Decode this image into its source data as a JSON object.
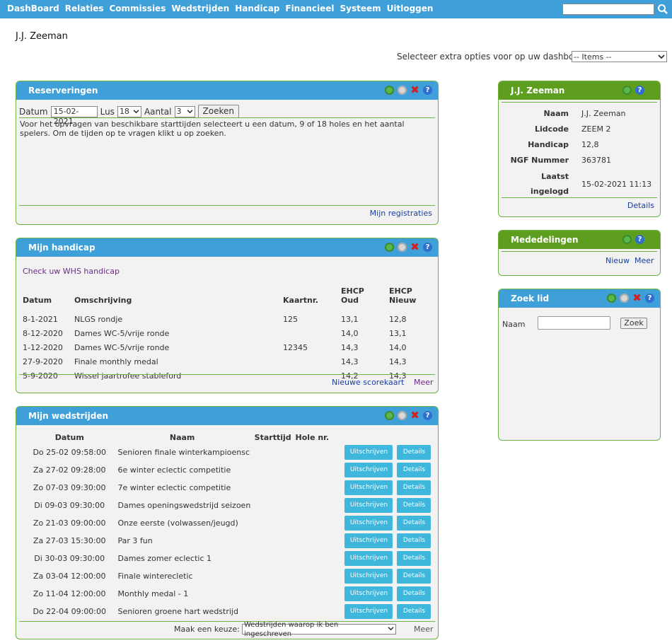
{
  "nav": {
    "items": [
      "DashBoard",
      "Relaties",
      "Commissies",
      "Wedstrijden",
      "Handicap",
      "Financieel",
      "Systeem",
      "Uitloggen"
    ],
    "search_value": ""
  },
  "user": {
    "name": "J.J. Zeeman"
  },
  "dashboard": {
    "extra_label": "Selecteer extra opties voor op uw dashboard",
    "extra_value": "-- Items --"
  },
  "reserveringen": {
    "title": "Reserveringen",
    "datum_label": "Datum",
    "datum_value": "15-02-2021",
    "lus_label": "Lus",
    "lus_value": "18",
    "aantal_label": "Aantal",
    "aantal_value": "3",
    "search_button": "Zoeken",
    "text": "Voor het opvragen van beschikbare starttijden selecteert u een datum, 9 of 18 holes en het aantal spelers. Om de tijden op te vragen klikt u op zoeken.",
    "link": "Mijn registraties"
  },
  "handicap": {
    "title": "Mijn handicap",
    "whs_link": "Check uw WHS handicap",
    "columns": [
      "Datum",
      "Omschrijving",
      "Kaartnr.",
      "EHCP Oud",
      "EHCP Nieuw"
    ],
    "rows": [
      [
        "8-1-2021",
        "NLGS rondje",
        "125",
        "13,1",
        "12,8"
      ],
      [
        "8-12-2020",
        "Dames WC-5/vrije ronde",
        "",
        "14,0",
        "13,1"
      ],
      [
        "1-12-2020",
        "Dames WC-5/vrije ronde",
        "12345",
        "14,3",
        "14,0"
      ],
      [
        "27-9-2020",
        "Finale monthly medal",
        "",
        "14,3",
        "14,3"
      ],
      [
        "5-9-2020",
        "Wissel jaartrofee stableford",
        "",
        "14,2",
        "14,3"
      ]
    ],
    "new_card_link": "Nieuwe scorekaart",
    "more_link": "Meer"
  },
  "wedstrijden": {
    "title": "Mijn wedstrijden",
    "columns": [
      "Datum",
      "Naam",
      "Starttijd",
      "Hole nr."
    ],
    "rows": [
      [
        "Do 25-02 09:58:00",
        "Senioren finale winterkampioenschap"
      ],
      [
        "Za 27-02 09:28:00",
        "6e winter eclectic competitie"
      ],
      [
        "Zo 07-03 09:30:00",
        "7e winter eclectic competitie"
      ],
      [
        "Di 09-03 09:30:00",
        "Dames openingswedstrijd seizoen"
      ],
      [
        "Zo 21-03 09:00:00",
        "Onze eerste (volwassen/jeugd)"
      ],
      [
        "Za 27-03 15:30:00",
        "Par 3 fun"
      ],
      [
        "Di 30-03 09:30:00",
        "Dames zomer eclectic 1"
      ],
      [
        "Za 03-04 12:00:00",
        "Finale winterecletic"
      ],
      [
        "Zo 11-04 12:00:00",
        "Monthly medal - 1"
      ],
      [
        "Do 22-04 09:00:00",
        "Senioren groene hart wedstrijd"
      ]
    ],
    "unsubscribe_label": "Uitschrijven",
    "details_label": "Details",
    "choice_label": "Maak een keuze:",
    "choice_value": "Wedstrijden waarop ik ben ingeschreven",
    "more_link": "Meer"
  },
  "profile": {
    "title": "J.J. Zeeman",
    "fields": [
      {
        "label": "Naam",
        "value": "J.J. Zeeman"
      },
      {
        "label": "Lidcode",
        "value": "ZEEM 2"
      },
      {
        "label": "Handicap",
        "value": "12,8"
      },
      {
        "label": "NGF Nummer",
        "value": "363781"
      },
      {
        "label": "Laatst ingelogd",
        "value": "15-02-2021 11:13"
      }
    ],
    "details_link": "Details"
  },
  "mededelingen": {
    "title": "Mededelingen",
    "new_link": "Nieuw",
    "more_link": "Meer"
  },
  "zoeklid": {
    "title": "Zoek lid",
    "name_label": "Naam",
    "name_value": "",
    "search_button": "Zoek"
  },
  "colors": {
    "nav_blue": "#3f9fd8",
    "panel_green": "#5e9e1e",
    "border_green": "#6db33f",
    "button_blue": "#3fb6dc"
  }
}
